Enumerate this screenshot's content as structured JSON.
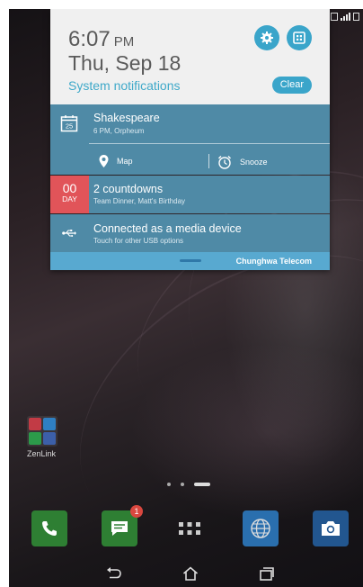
{
  "status_bar": {
    "icons": [
      "notification-box-icon",
      "signal-icon",
      "battery-icon"
    ]
  },
  "notification_shade": {
    "header": {
      "time": "6:07",
      "ampm": "PM",
      "date": "Thu, Sep 18",
      "system_notifications_label": "System notifications",
      "settings_icon": "gear-icon",
      "quick_settings_icon": "grid-icon",
      "clear_label": "Clear",
      "accent_color": "#3aa5ca"
    },
    "notifications": [
      {
        "icon": "calendar-icon",
        "calendar_day": "25",
        "title": "Shakespeare",
        "subtitle": "6 PM, Orpheum",
        "actions": [
          {
            "icon": "location-pin-icon",
            "label": "Map"
          },
          {
            "icon": "alarm-clock-icon",
            "label": "Snooze"
          }
        ]
      },
      {
        "badge_number": "00",
        "badge_unit": "DAY",
        "badge_color": "#e15459",
        "title": "2 countdowns",
        "subtitle": "Team Dinner, Matt's Birthday"
      },
      {
        "icon": "usb-icon",
        "title": "Connected as a media device",
        "subtitle": "Touch for other USB options"
      }
    ],
    "footer": {
      "carrier": "Chunghwa Telecom"
    },
    "background_color": "#4f8aa6"
  },
  "home": {
    "folder_label": "ZenLink",
    "page_count": 3,
    "active_page": 3,
    "dock": [
      {
        "name": "phone",
        "icon": "phone-icon",
        "color": "#2e9e3f"
      },
      {
        "name": "messages",
        "icon": "message-icon",
        "color": "#2e9e3f",
        "badge": "1"
      },
      {
        "name": "all-apps",
        "icon": "apps-grid-icon"
      },
      {
        "name": "browser",
        "icon": "globe-icon",
        "color": "#2f8fd6"
      },
      {
        "name": "camera",
        "icon": "camera-icon",
        "color": "#2f6fb6"
      }
    ]
  },
  "nav_bar": {
    "buttons": [
      "back-icon",
      "home-icon",
      "recent-apps-icon"
    ]
  }
}
